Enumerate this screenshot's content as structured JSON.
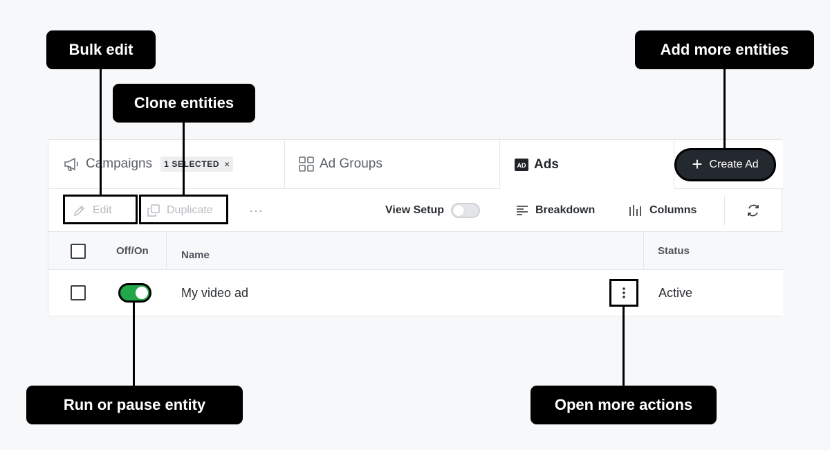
{
  "callouts": {
    "bulk_edit": "Bulk edit",
    "clone_entities": "Clone entities",
    "add_more_entities": "Add more entities",
    "run_or_pause": "Run or pause entity",
    "open_more_actions": "Open more actions"
  },
  "tabs": {
    "campaigns": "Campaigns",
    "selected_badge": "1 SELECTED",
    "badge_close": "×",
    "ad_groups": "Ad Groups",
    "ads_icon_text": "AD",
    "ads": "Ads"
  },
  "create_button": {
    "icon": "+",
    "label": "Create Ad"
  },
  "toolbar": {
    "edit": "Edit",
    "duplicate": "Duplicate",
    "more": "···",
    "view_setup": "View Setup",
    "breakdown": "Breakdown",
    "columns": "Columns"
  },
  "table": {
    "headers": {
      "toggle": "Off/On",
      "name": "Name",
      "status": "Status"
    },
    "rows": [
      {
        "name": "My video ad",
        "status": "Active",
        "enabled": true
      }
    ]
  },
  "colors": {
    "accent_toggle_on": "#22a84a",
    "create_button_bg": "#23292e",
    "callout_bg": "#000000"
  }
}
